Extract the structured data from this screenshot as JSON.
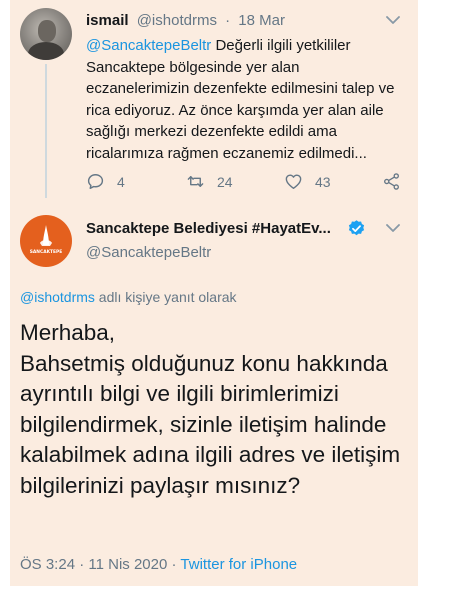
{
  "colors": {
    "card_background": "#fbece0",
    "link": "#1b95e0",
    "muted_text": "#657786",
    "primary_text": "#14171a",
    "brand_avatar": "#e4601e",
    "verified_badge": "#1da1f2"
  },
  "original_tweet": {
    "display_name": "ismail",
    "handle": "@ishotdrms",
    "separator": "·",
    "date": "18 Mar",
    "mention": "@SancaktepeBeltr",
    "text": " Değerli ilgili yetkililer Sancaktepe bölgesinde yer alan eczanelerimizin dezenfekte edilmesini talep ve rica ediyoruz. Az önce karşımda yer alan aile sağlığı merkezi dezenfekte edildi ama ricalarımıza rağmen eczanemiz edilmedi...",
    "replies_count": "4",
    "retweets_count": "24",
    "likes_count": "43",
    "icons": {
      "reply": "reply-icon",
      "retweet": "retweet-icon",
      "like": "heart-icon",
      "share": "share-icon",
      "more": "chevron-down-icon"
    }
  },
  "reply_tweet": {
    "display_name": "Sancaktepe Belediyesi #HayatEv...",
    "handle": "@SancaktepeBeltr",
    "avatar_text": "SANCAKTEPE",
    "verified": true,
    "reply_to_mention": "@ishotdrms",
    "reply_to_suffix": " adlı kişiye yanıt olarak",
    "text": "Merhaba,\nBahsetmiş olduğunuz konu hakkında ayrıntılı bilgi ve ilgili birimlerimizi bilgilendirmek, sizinle iletişim halinde kalabilmek adına ilgili adres ve iletişim bilgilerinizi paylaşır mısınız?",
    "time": "ÖS 3:24",
    "separator1": "·",
    "date": "11 Nis 2020",
    "separator2": "·",
    "source": "Twitter for iPhone"
  }
}
